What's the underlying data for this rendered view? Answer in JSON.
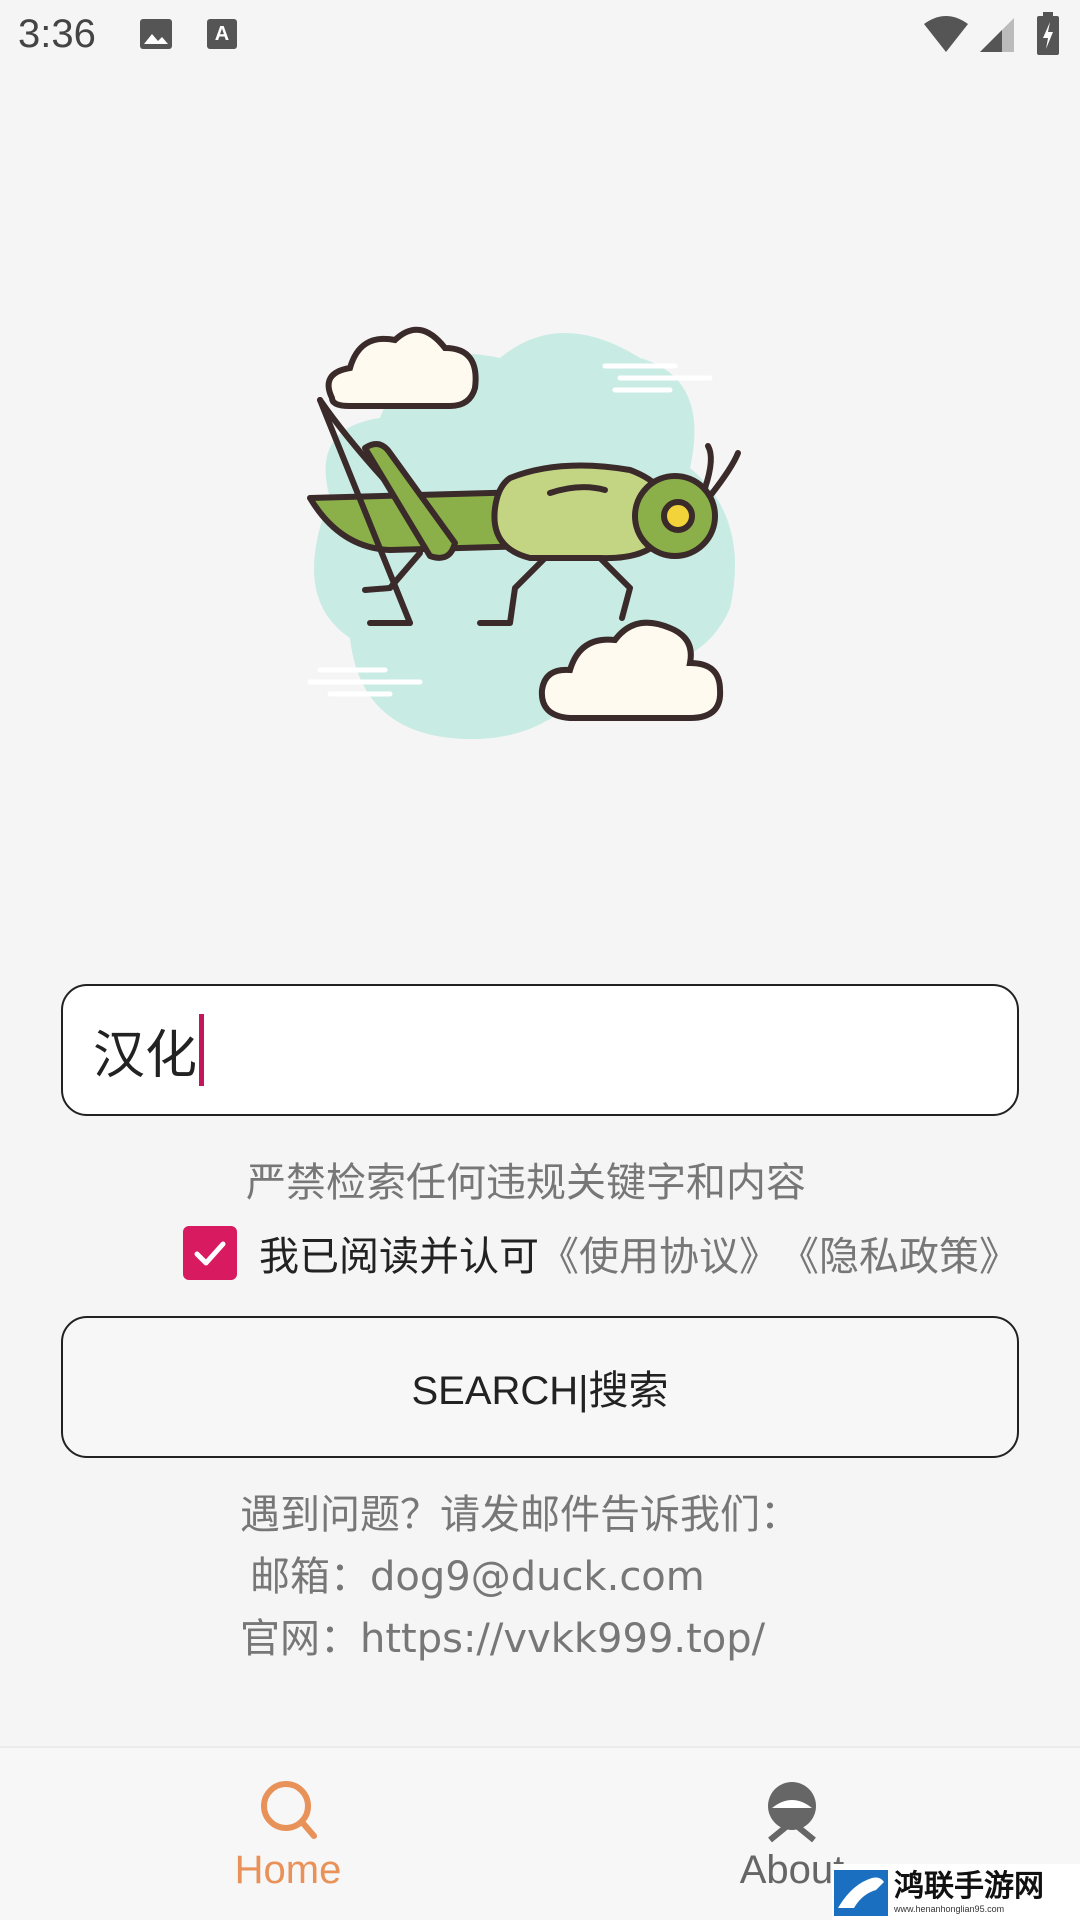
{
  "status_bar": {
    "time": "3:36",
    "icons": [
      "image-icon",
      "text-a-icon",
      "wifi-icon",
      "signal-icon",
      "battery-charging-icon"
    ]
  },
  "hero": {
    "icon": "grasshopper-illustration"
  },
  "search": {
    "value": "汉化"
  },
  "warning": "严禁检索任何违规关键字和内容",
  "agreement": {
    "checked": true,
    "text": "我已阅读并认可",
    "terms_link": "《使用协议》",
    "privacy_link": "《隐私政策》"
  },
  "search_button": {
    "label": "SEARCH|搜索"
  },
  "contact": {
    "line1": "遇到问题？请发邮件告诉我们：",
    "line2": "邮箱：dog9@duck.com",
    "line3": "官网：https://vvkk999.top/"
  },
  "bottom_nav": {
    "home": {
      "label": "Home",
      "icon": "search-icon",
      "color": "#e8925a"
    },
    "about": {
      "label": "About",
      "icon": "user-icon",
      "color": "#666666"
    }
  },
  "watermark": {
    "title": "鸿联手游网",
    "url": "www.henanhonglian95.com"
  },
  "colors": {
    "accent": "#d81b60",
    "nav_active": "#e8925a",
    "sky": "#c8ebe4",
    "grasshopper": "#8bb04a"
  }
}
